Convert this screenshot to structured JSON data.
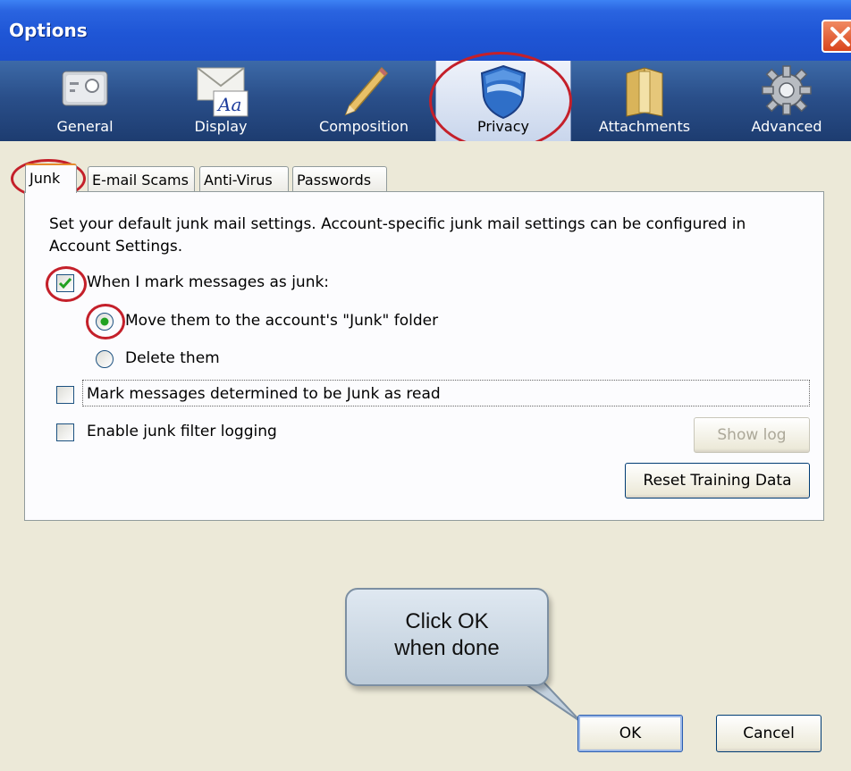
{
  "window": {
    "title": "Options"
  },
  "toolbar": {
    "items": [
      {
        "label": "General",
        "icon": "drive-icon"
      },
      {
        "label": "Display",
        "icon": "envelope-font-icon"
      },
      {
        "label": "Composition",
        "icon": "pencil-icon"
      },
      {
        "label": "Privacy",
        "icon": "shield-icon"
      },
      {
        "label": "Attachments",
        "icon": "folder-icon"
      },
      {
        "label": "Advanced",
        "icon": "gear-icon"
      }
    ],
    "selected": "Privacy"
  },
  "tabs": {
    "items": [
      "Junk",
      "E-mail Scams",
      "Anti-Virus",
      "Passwords"
    ],
    "selected": "Junk"
  },
  "junk": {
    "intro_line1": "Set your default junk mail settings. Account-specific junk mail settings can be configured in",
    "intro_line2": "Account Settings.",
    "mark_label": "When I mark messages as junk:",
    "mark_checked": true,
    "move_label": "Move them to the account's \"Junk\" folder",
    "move_selected": true,
    "delete_label": "Delete them",
    "mark_read_label": "Mark messages determined to be Junk as read",
    "mark_read_checked": false,
    "logging_label": "Enable junk filter logging",
    "logging_checked": false,
    "show_log_label": "Show log",
    "reset_label": "Reset Training Data"
  },
  "callout": {
    "line1": "Click OK",
    "line2": "when done"
  },
  "footer": {
    "ok_label": "OK",
    "cancel_label": "Cancel"
  },
  "colors": {
    "titlebar": "#1f56d6",
    "highlight_ring": "#c4202a",
    "accent_check": "#21a121"
  }
}
